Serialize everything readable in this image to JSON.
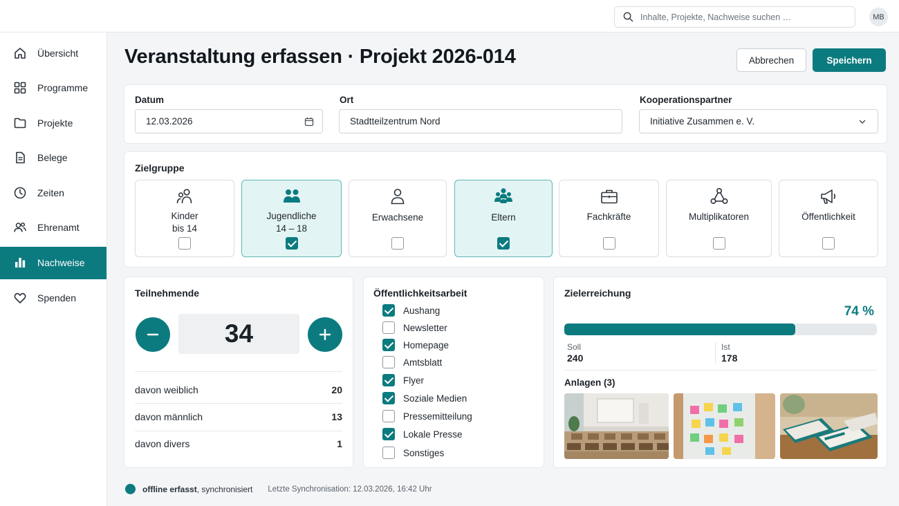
{
  "topbar": {
    "search_placeholder": "Inhalte, Projekte, Nachweise suchen …",
    "avatar_initials": "MB"
  },
  "sidebar": {
    "items": [
      {
        "label": "Übersicht",
        "icon": "home-icon"
      },
      {
        "label": "Programme",
        "icon": "grid-icon"
      },
      {
        "label": "Projekte",
        "icon": "folder-icon"
      },
      {
        "label": "Belege",
        "icon": "document-icon"
      },
      {
        "label": "Zeiten",
        "icon": "clock-icon"
      },
      {
        "label": "Ehrenamt",
        "icon": "people-icon"
      },
      {
        "label": "Nachweise",
        "icon": "bar-chart-icon",
        "active": true
      },
      {
        "label": "Spenden",
        "icon": "heart-icon"
      }
    ]
  },
  "page": {
    "title": "Veranstaltung erfassen · Projekt 2026-014",
    "cancel_label": "Abbrechen",
    "save_label": "Speichern"
  },
  "details": {
    "date_label": "Datum",
    "date_value": "12.03.2026",
    "location_label": "Ort",
    "location_value": "Stadtteilzentrum Nord",
    "partner_label": "Kooperationspartner",
    "partner_value": "Initiative Zusammen e. V."
  },
  "target_group": {
    "title": "Zielgruppe",
    "items": [
      {
        "line1": "Kinder",
        "line2": "bis 14",
        "checked": false,
        "icon": "children-icon"
      },
      {
        "line1": "Jugendliche",
        "line2": "14 – 18",
        "checked": true,
        "icon": "youth-icon"
      },
      {
        "line1": "Erwachsene",
        "line2": "",
        "checked": false,
        "icon": "person-icon"
      },
      {
        "line1": "Eltern",
        "line2": "",
        "checked": true,
        "icon": "family-icon"
      },
      {
        "line1": "Fachkräfte",
        "line2": "",
        "checked": false,
        "icon": "briefcase-icon"
      },
      {
        "line1": "Multiplikatoren",
        "line2": "",
        "checked": false,
        "icon": "network-icon"
      },
      {
        "line1": "Öffentlichkeit",
        "line2": "",
        "checked": false,
        "icon": "megaphone-icon"
      }
    ]
  },
  "participants": {
    "title": "Teilnehmende",
    "count": "34",
    "rows": [
      {
        "label": "davon weiblich",
        "value": "20"
      },
      {
        "label": "davon männlich",
        "value": "13"
      },
      {
        "label": "davon divers",
        "value": "1"
      }
    ]
  },
  "pr": {
    "title": "Öffentlichkeitsarbeit",
    "items": [
      {
        "label": "Aushang",
        "checked": true
      },
      {
        "label": "Newsletter",
        "checked": false
      },
      {
        "label": "Homepage",
        "checked": true
      },
      {
        "label": "Amtsblatt",
        "checked": false
      },
      {
        "label": "Flyer",
        "checked": true
      },
      {
        "label": "Soziale Medien",
        "checked": true
      },
      {
        "label": "Pressemitteilung",
        "checked": false
      },
      {
        "label": "Lokale Presse",
        "checked": true
      },
      {
        "label": "Sonstiges",
        "checked": false
      }
    ]
  },
  "goal": {
    "title": "Zielerreichung",
    "percent_label": "74 %",
    "progress": 0.74,
    "soll_label": "Soll",
    "soll_value": "240",
    "ist_label": "Ist",
    "ist_value": "178",
    "attachments_label": "Anlagen (3)",
    "attachments": [
      "seminar-room-photo",
      "sticky-notes-photo",
      "flyers-photo"
    ]
  },
  "status": {
    "state_bold": "offline erfasst",
    "state_rest": ", synchronisiert",
    "last_sync": "Letzte Synchronisation: 12.03.2026, 16:42 Uhr"
  },
  "colors": {
    "accent": "#0c7b80",
    "selected_bg": "#e3f4f4",
    "background": "#f3f5f7"
  }
}
